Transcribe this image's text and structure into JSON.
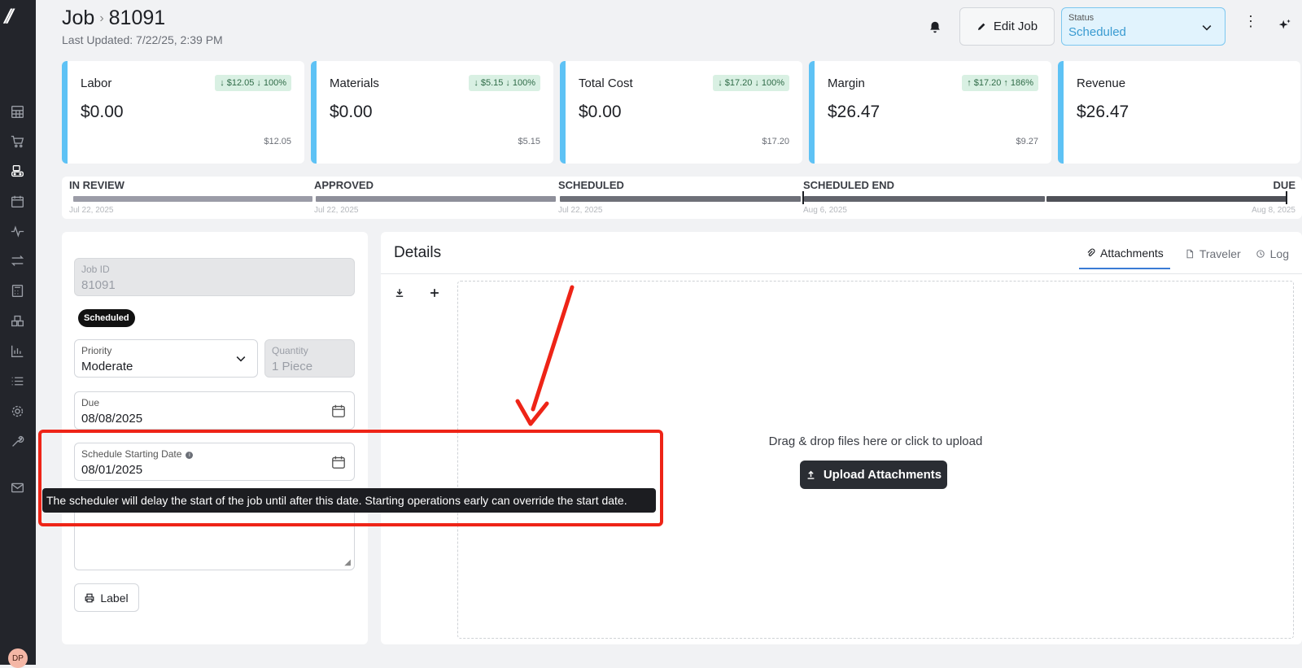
{
  "header": {
    "title": "Job",
    "separator": "›",
    "job_number": "81091",
    "last_updated": "Last Updated: 7/22/25, 2:39 PM",
    "edit_label": "Edit Job",
    "status_label": "Status",
    "status_value": "Scheduled",
    "kebab": "⋮"
  },
  "cards": [
    {
      "name": "Labor",
      "value": "$0.00",
      "prev": "$12.05",
      "badge_amount": "$12.05",
      "badge_pct": "100%",
      "trend": "down"
    },
    {
      "name": "Materials",
      "value": "$0.00",
      "prev": "$5.15",
      "badge_amount": "$5.15",
      "badge_pct": "100%",
      "trend": "down"
    },
    {
      "name": "Total Cost",
      "value": "$0.00",
      "prev": "$17.20",
      "badge_amount": "$17.20",
      "badge_pct": "100%",
      "trend": "down"
    },
    {
      "name": "Margin",
      "value": "$26.47",
      "prev": "$9.27",
      "badge_amount": "$17.20",
      "badge_pct": "186%",
      "trend": "up"
    },
    {
      "name": "Revenue",
      "value": "$26.47"
    }
  ],
  "timeline": {
    "stages": [
      {
        "label": "IN REVIEW",
        "date": "Jul 22, 2025"
      },
      {
        "label": "APPROVED",
        "date": "Jul 22, 2025"
      },
      {
        "label": "SCHEDULED",
        "date": "Jul 22, 2025"
      },
      {
        "label": "SCHEDULED END",
        "date": "Aug 6, 2025"
      },
      {
        "label": "DUE",
        "date": "Aug 8, 2025"
      }
    ]
  },
  "form": {
    "job_id_label": "Job ID",
    "job_id_value": "81091",
    "status_pill": "Scheduled",
    "priority_label": "Priority",
    "priority_value": "Moderate",
    "quantity_label": "Quantity",
    "quantity_value": "1 Piece",
    "due_label": "Due",
    "due_value": "08/08/2025",
    "start_label": "Schedule Starting Date",
    "start_value": "08/01/2025",
    "label_button": "Label"
  },
  "tooltip": "The scheduler will delay the start of the job until after this date. Starting operations early can override the start date.",
  "details": {
    "title": "Details",
    "tabs": [
      "Attachments",
      "Traveler",
      "Log"
    ],
    "drop_text": "Drag & drop files here or click to upload",
    "upload_label": "Upload Attachments"
  },
  "user": {
    "initials": "DP"
  },
  "colors": {
    "accent": "#5ec2f5",
    "annotation": "#ee2417",
    "status_bg": "#e1f3fd",
    "badge_bg": "#d9f0e3"
  }
}
